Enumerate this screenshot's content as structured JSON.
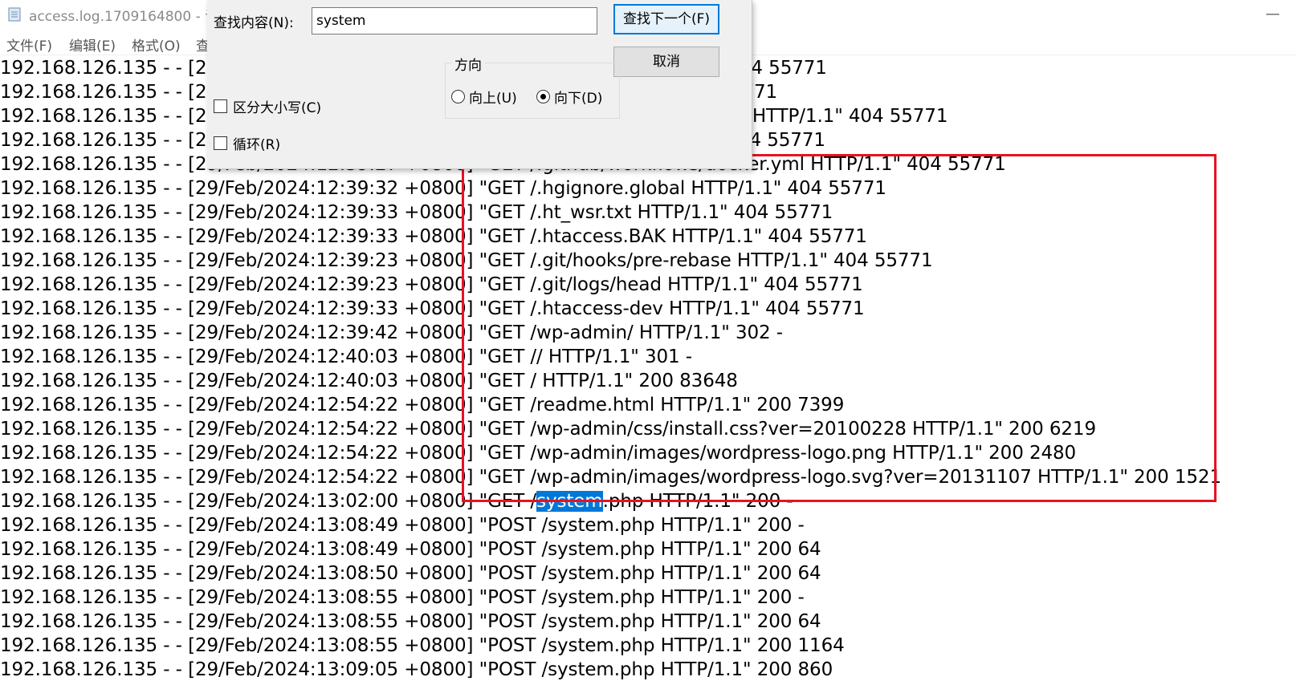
{
  "window": {
    "title": "access.log.1709164800 - 记",
    "minimize_symbol": "—"
  },
  "menu": [
    "文件(F)",
    "编辑(E)",
    "格式(O)",
    "查"
  ],
  "find_dialog": {
    "find_label": "查找内容(N):",
    "find_value": "system",
    "find_next": "查找下一个(F)",
    "cancel": "取消",
    "direction_label": "方向",
    "up_label": "向上(U)",
    "down_label": "向下(D)",
    "direction_selected": "down",
    "match_case_label": "区分大小写(C)",
    "wrap_label": "循环(R)"
  },
  "log_lines": [
    "192.168.126.135 - - [29/Feb/2024:12:39:26 +0800] \"GET /.DS_Store HTTP/1.1\" 404 55771",
    "192.168.126.135 - - [29/Feb/2024:12:39:26 +0800] \"GET /.env HTTP/1.1\" 404 55771",
    "192.168.126.135 - - [29/Feb/2024:12:39:27 +0800] \"GET /.git/refs/remotes/origin HTTP/1.1\" 404 55771",
    "192.168.126.135 - - [29/Feb/2024:12:39:27 +0800] \"GET /.gitignore HTTP/1.1\" 404 55771",
    "192.168.126.135 - - [29/Feb/2024:12:39:27 +0800] \"GET /.github/workflows/docker.yml HTTP/1.1\" 404 55771",
    "192.168.126.135 - - [29/Feb/2024:12:39:32 +0800] \"GET /.hgignore.global HTTP/1.1\" 404 55771",
    "192.168.126.135 - - [29/Feb/2024:12:39:33 +0800] \"GET /.ht_wsr.txt HTTP/1.1\" 404 55771",
    "192.168.126.135 - - [29/Feb/2024:12:39:33 +0800] \"GET /.htaccess.BAK HTTP/1.1\" 404 55771",
    "192.168.126.135 - - [29/Feb/2024:12:39:23 +0800] \"GET /.git/hooks/pre-rebase HTTP/1.1\" 404 55771",
    "192.168.126.135 - - [29/Feb/2024:12:39:23 +0800] \"GET /.git/logs/head HTTP/1.1\" 404 55771",
    "192.168.126.135 - - [29/Feb/2024:12:39:33 +0800] \"GET /.htaccess-dev HTTP/1.1\" 404 55771",
    "192.168.126.135 - - [29/Feb/2024:12:39:42 +0800] \"GET /wp-admin/ HTTP/1.1\" 302 -",
    "192.168.126.135 - - [29/Feb/2024:12:40:03 +0800] \"GET // HTTP/1.1\" 301 -",
    "192.168.126.135 - - [29/Feb/2024:12:40:03 +0800] \"GET / HTTP/1.1\" 200 83648",
    "192.168.126.135 - - [29/Feb/2024:12:54:22 +0800] \"GET /readme.html HTTP/1.1\" 200 7399",
    "192.168.126.135 - - [29/Feb/2024:12:54:22 +0800] \"GET /wp-admin/css/install.css?ver=20100228 HTTP/1.1\" 200 6219",
    "192.168.126.135 - - [29/Feb/2024:12:54:22 +0800] \"GET /wp-admin/images/wordpress-logo.png HTTP/1.1\" 200 2480",
    "192.168.126.135 - - [29/Feb/2024:12:54:22 +0800] \"GET /wp-admin/images/wordpress-logo.svg?ver=20131107 HTTP/1.1\" 200 1521",
    "192.168.126.135 - - [29/Feb/2024:13:02:00 +0800] \"GET /system.php HTTP/1.1\" 200 -",
    "192.168.126.135 - - [29/Feb/2024:13:08:49 +0800] \"POST /system.php HTTP/1.1\" 200 -",
    "192.168.126.135 - - [29/Feb/2024:13:08:49 +0800] \"POST /system.php HTTP/1.1\" 200 64",
    "192.168.126.135 - - [29/Feb/2024:13:08:50 +0800] \"POST /system.php HTTP/1.1\" 200 64",
    "192.168.126.135 - - [29/Feb/2024:13:08:55 +0800] \"POST /system.php HTTP/1.1\" 200 -",
    "192.168.126.135 - - [29/Feb/2024:13:08:55 +0800] \"POST /system.php HTTP/1.1\" 200 64",
    "192.168.126.135 - - [29/Feb/2024:13:08:55 +0800] \"POST /system.php HTTP/1.1\" 200 1164",
    "192.168.126.135 - - [29/Feb/2024:13:09:05 +0800] \"POST /system.php HTTP/1.1\" 200 860"
  ],
  "highlight": {
    "line_index": 18,
    "text": "system"
  },
  "annotation_box_color": "#e81123",
  "selection_color": "#0078d7"
}
